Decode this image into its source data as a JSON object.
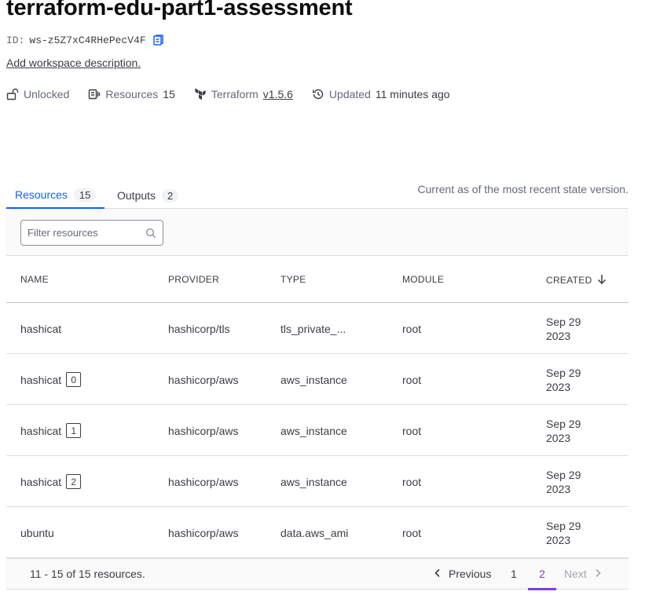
{
  "workspace": {
    "title": "terraform-edu-part1-assessment",
    "id_label": "ID:",
    "id_value": "ws-z5Z7xC4RHePecV4F",
    "description_link": "Add workspace description."
  },
  "meta": {
    "lock_status": "Unlocked",
    "resources_label": "Resources",
    "resources_count": "15",
    "terraform_label": "Terraform",
    "terraform_version": "v1.5.6",
    "updated_label": "Updated",
    "updated_value": "11 minutes ago"
  },
  "tabs": [
    {
      "label": "Resources",
      "count": "15",
      "active": true
    },
    {
      "label": "Outputs",
      "count": "2",
      "active": false
    }
  ],
  "tab_note": "Current as of the most recent state version.",
  "filter": {
    "placeholder": "Filter resources",
    "value": ""
  },
  "table": {
    "columns": [
      "NAME",
      "PROVIDER",
      "TYPE",
      "MODULE",
      "CREATED"
    ],
    "sort_column": "CREATED",
    "sort_direction": "descending",
    "rows": [
      {
        "name": "hashicat",
        "index": "",
        "provider": "hashicorp/tls",
        "type": "tls_private_...",
        "module": "root",
        "created_line1": "Sep 29",
        "created_line2": "2023"
      },
      {
        "name": "hashicat",
        "index": "0",
        "provider": "hashicorp/aws",
        "type": "aws_instance",
        "module": "root",
        "created_line1": "Sep 29",
        "created_line2": "2023"
      },
      {
        "name": "hashicat",
        "index": "1",
        "provider": "hashicorp/aws",
        "type": "aws_instance",
        "module": "root",
        "created_line1": "Sep 29",
        "created_line2": "2023"
      },
      {
        "name": "hashicat",
        "index": "2",
        "provider": "hashicorp/aws",
        "type": "aws_instance",
        "module": "root",
        "created_line1": "Sep 29",
        "created_line2": "2023"
      },
      {
        "name": "ubuntu",
        "index": "",
        "provider": "hashicorp/aws",
        "type": "data.aws_ami",
        "module": "root",
        "created_line1": "Sep 29",
        "created_line2": "2023"
      }
    ]
  },
  "pagination": {
    "summary": "11 - 15 of 15 resources.",
    "previous_label": "Previous",
    "next_label": "Next",
    "pages": [
      "1",
      "2"
    ],
    "current_page": "2"
  },
  "colors": {
    "accent_blue": "#1060ff",
    "page_active_purple": "#7b3fe4",
    "text_primary": "#3b3d45",
    "text_muted": "#656a76"
  },
  "icons": [
    "copy-icon",
    "unlock-icon",
    "resources-icon",
    "terraform-logo-icon",
    "history-icon",
    "search-icon",
    "arrow-down-icon",
    "chevron-left-icon",
    "chevron-right-icon"
  ]
}
